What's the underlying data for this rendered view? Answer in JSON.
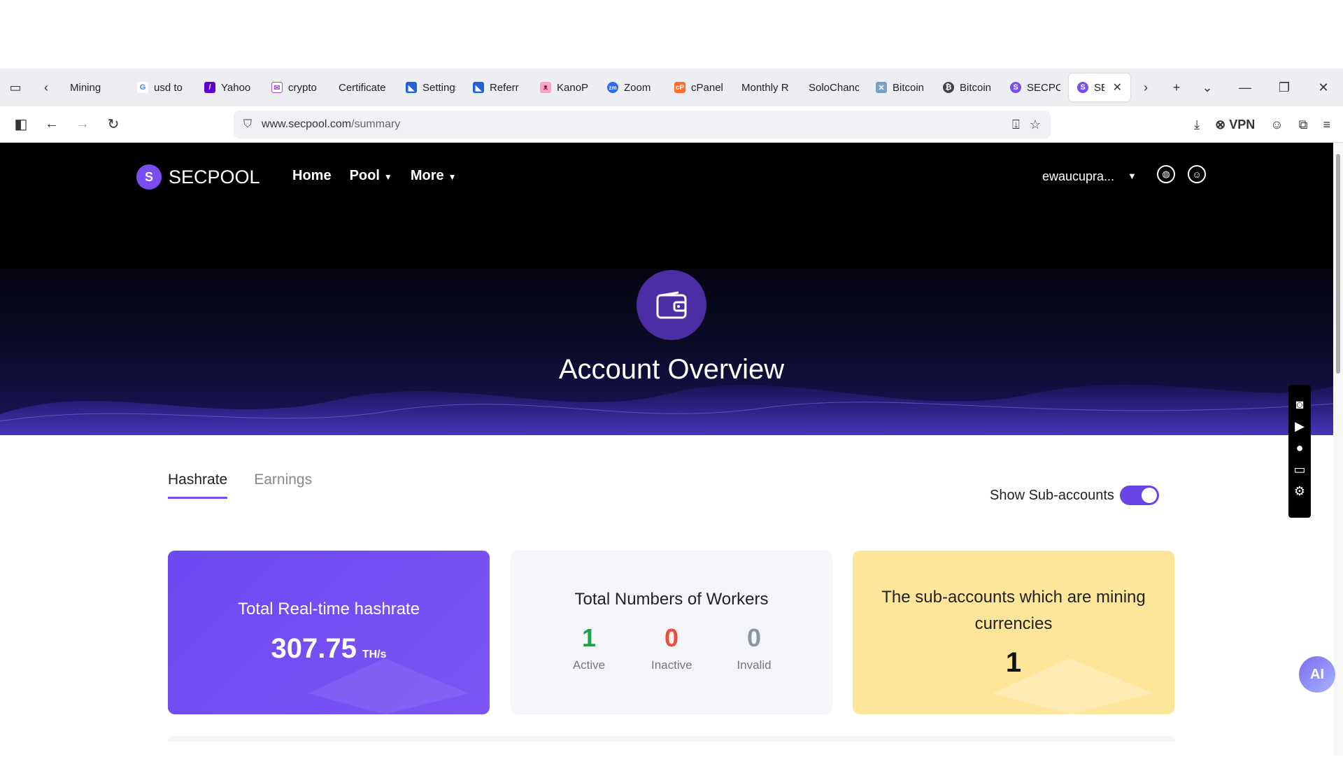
{
  "browser": {
    "tabs": [
      {
        "label": "Mining",
        "favicon": "tab-icon"
      },
      {
        "label": "usd to",
        "favicon": "google-icon"
      },
      {
        "label": "Yahoo",
        "favicon": "yahoo-icon"
      },
      {
        "label": "crypto",
        "favicon": "mail-icon"
      },
      {
        "label": "Certificate",
        "favicon": "none"
      },
      {
        "label": "Settings",
        "favicon": "flag-icon"
      },
      {
        "label": "Referr",
        "favicon": "flag-icon"
      },
      {
        "label": "KanoP",
        "favicon": "cat-icon"
      },
      {
        "label": "Zoom",
        "favicon": "zoom-icon"
      },
      {
        "label": "cPanel",
        "favicon": "cpanel-icon"
      },
      {
        "label": "Monthly R",
        "favicon": "none"
      },
      {
        "label": "SoloChanc",
        "favicon": "none"
      },
      {
        "label": "Bitcoin",
        "favicon": "bitcoin-icon"
      },
      {
        "label": "Bitcoin",
        "favicon": "bitcoin-icon"
      },
      {
        "label": "SECPC",
        "favicon": "secpool-icon"
      }
    ],
    "active_tab": {
      "label": "SEC"
    },
    "url_host": "www.secpool.com",
    "url_path": "/summary",
    "vpn_label": "VPN"
  },
  "site": {
    "logo_text": "SECPOOL",
    "menu": {
      "home": "Home",
      "pool": "Pool",
      "more": "More"
    },
    "username": "ewaucupra...",
    "hero_title": "Account Overview"
  },
  "overview": {
    "tabs": {
      "hashrate": "Hashrate",
      "earnings": "Earnings"
    },
    "show_subaccounts_label": "Show Sub-accounts",
    "show_subaccounts_on": true,
    "card_hashrate": {
      "title": "Total Real-time hashrate",
      "value": "307.75",
      "unit": "TH/s"
    },
    "card_workers": {
      "title": "Total Numbers of Workers",
      "active": {
        "value": "1",
        "label": "Active",
        "color": "#1fa34a"
      },
      "inactive": {
        "value": "0",
        "label": "Inactive",
        "color": "#f04a3a"
      },
      "invalid": {
        "value": "0",
        "label": "Invalid",
        "color": "#8a96a6"
      }
    },
    "card_subaccounts": {
      "title": "The sub-accounts which are mining currencies",
      "value": "1"
    }
  },
  "widgets": {
    "ai_label": "AI"
  }
}
